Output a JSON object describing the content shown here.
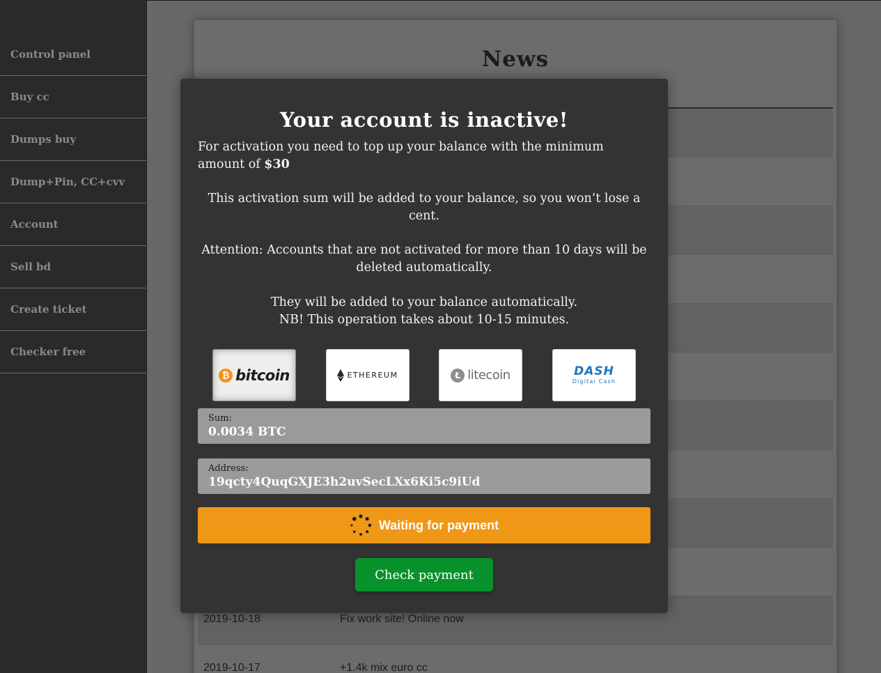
{
  "sidebar": {
    "items": [
      {
        "label": "Control panel"
      },
      {
        "label": "Buy cc"
      },
      {
        "label": "Dumps buy"
      },
      {
        "label": "Dump+Pin, CC+cvv"
      },
      {
        "label": "Account"
      },
      {
        "label": "Sell bd"
      },
      {
        "label": "Create ticket"
      },
      {
        "label": "Checker free"
      }
    ]
  },
  "news": {
    "title": "News",
    "rows": [
      {
        "date": "",
        "text": ""
      },
      {
        "date": "",
        "text": ""
      },
      {
        "date": "",
        "text": ""
      },
      {
        "date": "",
        "text": ""
      },
      {
        "date": "",
        "text": ""
      },
      {
        "date": "",
        "text": ""
      },
      {
        "date": "",
        "text": ""
      },
      {
        "date": "",
        "text": ""
      },
      {
        "date": "",
        "text": ""
      },
      {
        "date": "",
        "text": ""
      },
      {
        "date": "2019-10-18",
        "text": "Fix work site! Online now"
      },
      {
        "date": "2019-10-17",
        "text": "+1.4k mix euro cc"
      }
    ]
  },
  "modal": {
    "title": "Your account is inactive!",
    "line1_prefix": "For activation you need to top up your balance with the minimum amount of ",
    "line1_amount": "$30",
    "line2": "This activation sum will be added to your balance, so you won’t lose a cent.",
    "line3": "Attention: Accounts that are not activated for more than 10 days will be deleted automatically.",
    "line4a": "They will be added to your balance automatically.",
    "line4b": "NB! This operation takes about 10-15 minutes.",
    "coins": {
      "bitcoin": {
        "symbol": "₿",
        "word": "bitcoin",
        "selected": true
      },
      "ethereum": {
        "word": "ETHEREUM"
      },
      "litecoin": {
        "symbol": "Ł",
        "word": "litecoin"
      },
      "dash": {
        "word": "DASH",
        "sub": "Digital Cash"
      }
    },
    "sum_label": "Sum:",
    "sum_value": "0.0034 BTC",
    "address_label": "Address:",
    "address_value": "19qcty4QuqGXJE3h2uvSecLXx6Ki5c9iUd",
    "waiting_label": "Waiting for payment",
    "check_label": "Check payment"
  },
  "colors": {
    "sidebar_bg": "#2a2a2a",
    "modal_bg": "#333333",
    "waiting_bg": "#ef9716",
    "check_bg": "#07922b",
    "bitcoin_orange": "#f7931a",
    "dash_blue": "#1c75bc"
  }
}
